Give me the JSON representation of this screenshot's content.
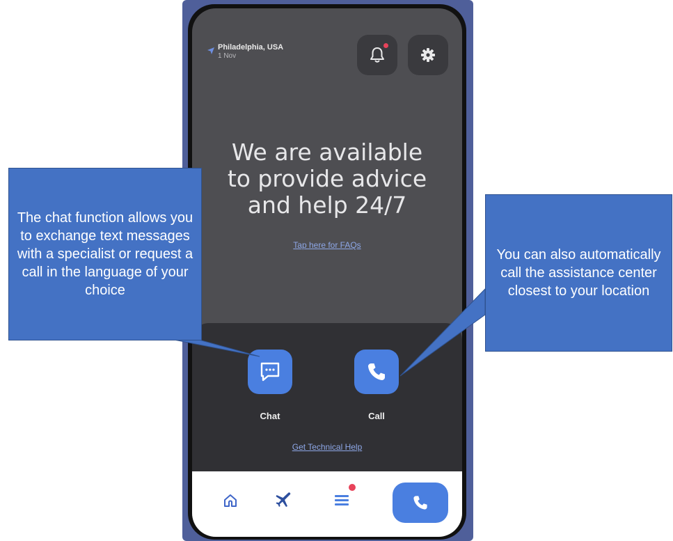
{
  "header": {
    "location_city": "Philadelphia, USA",
    "location_date": "1 Nov"
  },
  "headline": {
    "line1": "We are available",
    "line2": "to provide advice",
    "line3": "and help 24/7"
  },
  "links": {
    "faq": "Tap here for FAQs",
    "technical_help": "Get Technical Help"
  },
  "actions": {
    "chat_label": "Chat",
    "call_label": "Call"
  },
  "tabbar": {
    "items": [
      "home-icon",
      "plane-icon",
      "list-icon",
      "phone-icon"
    ],
    "active": "phone-icon"
  },
  "callouts": {
    "left": "The chat function allows you to exchange text messages with a specialist or request a call in the language of your choice",
    "right": "You can also automatically call the assistance center closest to your location"
  },
  "colors": {
    "accent": "#4a7fe0",
    "callout": "#4472c4",
    "notification": "#e8435a"
  }
}
